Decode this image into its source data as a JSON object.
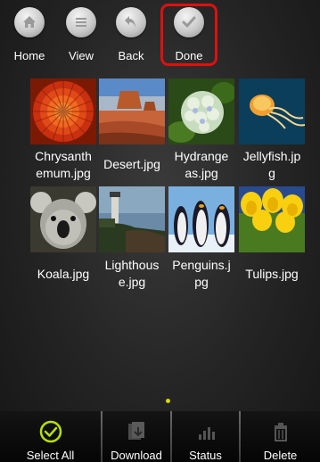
{
  "toolbar": {
    "home_label": "Home",
    "view_label": "View",
    "back_label": "Back",
    "done_label": "Done",
    "highlight_color": "#e01010"
  },
  "files": [
    {
      "name": "Chrysanthemum.jpg",
      "display": "Chrysanth\nemum.jpg",
      "icon": "chrysanthemum-thumbnail"
    },
    {
      "name": "Desert.jpg",
      "display": "Desert.jpg",
      "icon": "desert-thumbnail"
    },
    {
      "name": "Hydrangeas.jpg",
      "display": "Hydrange\nas.jpg",
      "icon": "hydrangeas-thumbnail"
    },
    {
      "name": "Jellyfish.jpg",
      "display": "Jellyfish.jp\ng",
      "icon": "jellyfish-thumbnail"
    },
    {
      "name": "Koala.jpg",
      "display": "Koala.jpg",
      "icon": "koala-thumbnail"
    },
    {
      "name": "Lighthouse.jpg",
      "display": "Lighthous\ne.jpg",
      "icon": "lighthouse-thumbnail"
    },
    {
      "name": "Penguins.jpg",
      "display": "Penguins.j\npg",
      "icon": "penguins-thumbnail"
    },
    {
      "name": "Tulips.jpg",
      "display": "Tulips.jpg",
      "icon": "tulips-thumbnail"
    }
  ],
  "bottombar": {
    "select_all_label": "Select All",
    "download_label": "Download",
    "status_label": "Status",
    "delete_label": "Delete",
    "accent_color": "#b8e000"
  },
  "pager": {
    "current_page": 1
  }
}
